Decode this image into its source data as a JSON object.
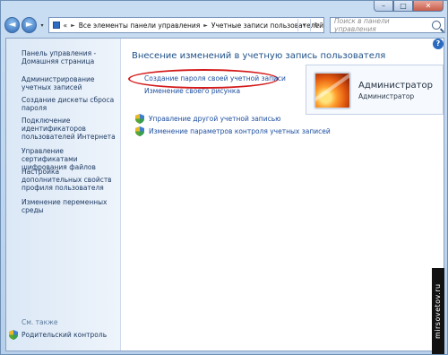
{
  "window": {
    "minimize_glyph": "–",
    "maximize_glyph": "□",
    "close_glyph": "✕"
  },
  "nav": {
    "back_glyph": "◄",
    "forward_glyph": "►",
    "history_glyph": "▾"
  },
  "address": {
    "chevron": "«",
    "crumb1": "Все элементы панели управления",
    "separator": "►",
    "crumb2": "Учетные записи пользователей",
    "dropdown_glyph": "▾",
    "refresh_glyph": "↻"
  },
  "search": {
    "placeholder": "Поиск в панели управления"
  },
  "sidebar": {
    "home": "Панель управления - Домашняя страница",
    "items": [
      "Администрирование учетных записей",
      "Создание дискеты сброса пароля",
      "Подключение идентификаторов пользователей Интернета",
      "Управление сертификатами шифрования файлов",
      "Настройка дополнительных свойств профиля пользователя",
      "Изменение переменных среды"
    ],
    "see_also": "См. также",
    "parental_control": "Родительский контроль"
  },
  "main": {
    "heading": "Внесение изменений в учетную запись пользователя",
    "create_password": "Создание пароля своей учетной записи",
    "change_picture": "Изменение своего рисунка",
    "manage_other": "Управление другой учетной записью",
    "uac_settings": "Изменение параметров контроля учетных записей"
  },
  "user": {
    "name": "Администратор",
    "role": "Администратор"
  },
  "help_glyph": "?",
  "watermark": "mirsovetov.ru",
  "colors": {
    "link": "#1e4fa0",
    "highlight": "#d41919",
    "heading": "#1e4f88"
  }
}
